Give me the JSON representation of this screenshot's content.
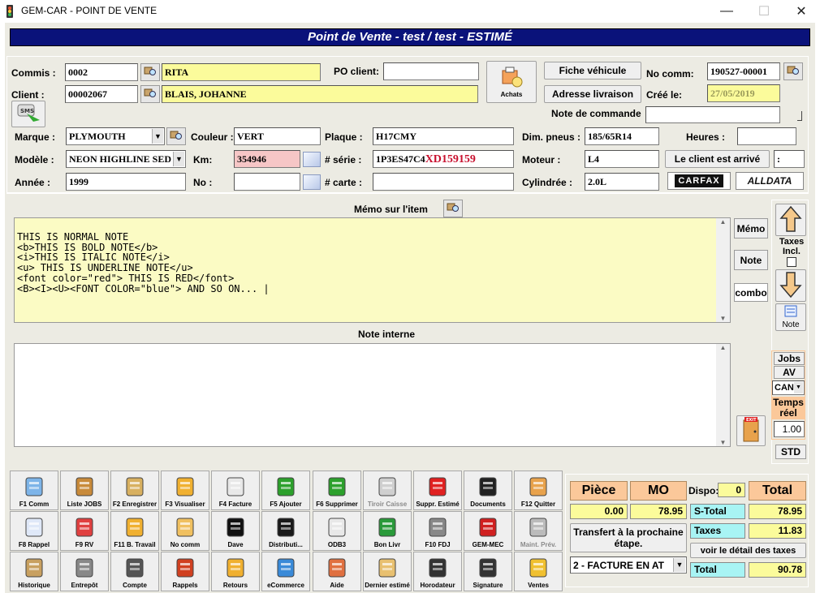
{
  "window": {
    "title": "GEM-CAR - POINT DE VENTE",
    "minimize": "—",
    "maximize": "☐",
    "close": "✕"
  },
  "banner": {
    "title": "Point de Vente - test / test - ESTIMÉ"
  },
  "form": {
    "commis_label": "Commis :",
    "commis_code": "0002",
    "commis_name": "RITA",
    "client_label": "Client :",
    "client_code": "00002067",
    "client_name": "BLAIS, JOHANNE",
    "po_label": "PO client:",
    "po_value": "",
    "achats_label": "Achats",
    "fiche_btn": "Fiche véhicule",
    "adresse_btn": "Adresse livraison",
    "nocomm_label": "No comm:",
    "nocomm_value": "190527-00001",
    "cree_label": "Créé le:",
    "cree_value": "27/05/2019",
    "note_cmd_label": "Note de commande",
    "note_cmd_value": "",
    "sms_label": "SMS"
  },
  "vehicle": {
    "marque_label": "Marque :",
    "marque_value": "PLYMOUTH",
    "modele_label": "Modèle :",
    "modele_value": "NEON HIGHLINE SED",
    "annee_label": "Année :",
    "annee_value": "1999",
    "couleur_label": "Couleur :",
    "couleur_value": "VERT",
    "km_label": "Km:",
    "km_value": "354946",
    "no_label": "No :",
    "no_value": "",
    "plaque_label": "Plaque :",
    "plaque_value": "H17CMY",
    "serie_label": "# série :",
    "serie_prefix": "1P3ES47C4",
    "serie_suffix": "XD159159",
    "carte_label": "# carte :",
    "carte_value": "",
    "pneus_label": "Dim. pneus :",
    "pneus_value": "185/65R14",
    "moteur_label": "Moteur :",
    "moteur_value": "L4",
    "cyl_label": "Cylindrée :",
    "cyl_value": "2.0L",
    "heures_label": "Heures :",
    "heures_value": "",
    "arrive_btn": "Le client est arrivé",
    "arrive_value": ":",
    "carfax": "CARFAX",
    "alldata": "ALLDATA"
  },
  "memo": {
    "title": "Mémo sur l'item",
    "lines": [
      "THIS IS NORMAL NOTE",
      "<b>THIS IS BOLD NOTE</b>",
      "<i>THIS IS ITALIC NOTE</i>",
      "<u> THIS IS UNDERLINE NOTE</u>",
      "<font color=\"red\"> THIS IS RED</font>",
      "<B><I><U><FONT COLOR=\"blue\"> AND SO ON... |"
    ],
    "btn_memo": "Mémo",
    "btn_note": "Note",
    "btn_combo": "combo"
  },
  "note_interne": {
    "title": "Note interne",
    "value": ""
  },
  "side": {
    "taxes_incl": "Taxes Incl.",
    "note": "Note",
    "jobs": "Jobs",
    "av": "AV",
    "can": "CAN",
    "temps_reel": "Temps réel",
    "temps_value": "1.00",
    "std": "STD"
  },
  "fkeys": [
    [
      "F1 Comm",
      "Liste JOBS",
      "F2 Enregistrer",
      "F3 Visualiser",
      "F4 Facture",
      "F5 Ajouter",
      "F6 Supprimer",
      "Tiroir Caisse",
      "Suppr. Estimé",
      "Documents",
      "F12 Quitter"
    ],
    [
      "F8 Rappel",
      "F9 RV",
      "F11 B. Travail",
      "No comm",
      "Dave",
      "Distributi...",
      "ODB3",
      "Bon Livr",
      "F10 FDJ",
      "GEM-MEC",
      "Maint. Prév."
    ],
    [
      "Historique",
      "Entrepôt",
      "Compte",
      "Rappels",
      "Retours",
      "eCommerce",
      "Aide",
      "Dernier estimé",
      "Horodateur",
      "Signature",
      "Ventes"
    ]
  ],
  "totals": {
    "piece_label": "Pièce",
    "mo_label": "MO",
    "dispo_label": "Dispo:",
    "dispo_value": "0",
    "total_label": "Total",
    "piece_value": "0.00",
    "mo_value": "78.95",
    "stotal_label": "S-Total",
    "stotal_value": "78.95",
    "taxes_label": "Taxes",
    "taxes_value": "11.83",
    "total_row_label": "Total",
    "total_value": "90.78",
    "transfert_btn": "Transfert à la prochaine étape.",
    "detail_btn": "voir le détail des taxes",
    "etape_value": "2 - FACTURE EN AT"
  },
  "colors": {
    "banner": "#0a127a",
    "panel": "#ecebe3",
    "yellow": "#fbfb9b",
    "orange": "#fbc89a",
    "cyan": "#a8f4f4"
  }
}
